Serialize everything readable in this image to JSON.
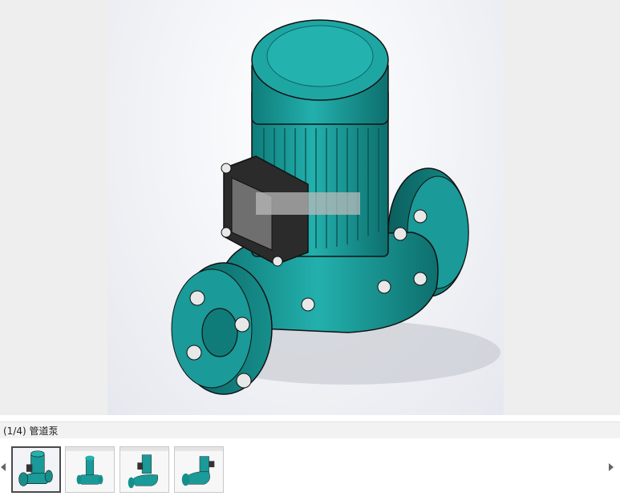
{
  "viewer": {
    "caption": "(1/4) 管道泵",
    "image_subject": "pipeline-pump-cad-render",
    "colors": {
      "pump_body": "#1a9a98",
      "background": "#eeeeee"
    }
  },
  "thumbnails": [
    {
      "label": "thumbnail-1",
      "active": true
    },
    {
      "label": "thumbnail-2",
      "active": false
    },
    {
      "label": "thumbnail-3",
      "active": false
    },
    {
      "label": "thumbnail-4",
      "active": false
    }
  ],
  "icons": {
    "prev": "chevron-left-icon",
    "next": "chevron-right-icon"
  }
}
